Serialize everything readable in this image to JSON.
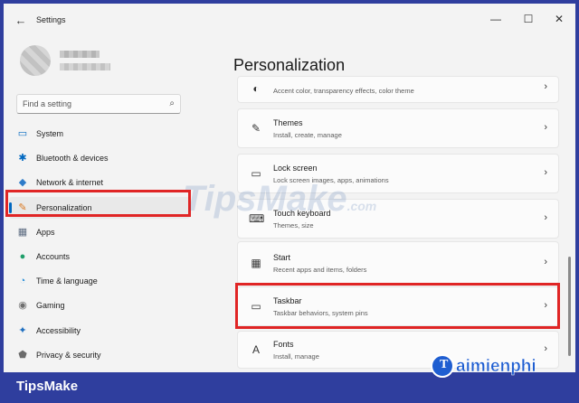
{
  "window": {
    "title": "Settings"
  },
  "controls": {
    "back": "←",
    "minimize": "—",
    "maximize": "☐",
    "close": "✕"
  },
  "search": {
    "placeholder": "Find a setting",
    "icon": "⌕"
  },
  "sidebar": {
    "items": [
      {
        "label": "System",
        "icon": "▭",
        "color": "#0067c0"
      },
      {
        "label": "Bluetooth & devices",
        "icon": "✱",
        "color": "#0067c0"
      },
      {
        "label": "Network & internet",
        "icon": "◆",
        "color": "#2f7cc9"
      },
      {
        "label": "Personalization",
        "icon": "✎",
        "color": "#d9771f",
        "active": true
      },
      {
        "label": "Apps",
        "icon": "▦",
        "color": "#5c6b80"
      },
      {
        "label": "Accounts",
        "icon": "●",
        "color": "#1f9e6a"
      },
      {
        "label": "Time & language",
        "icon": "◔",
        "color": "#2a8fd8"
      },
      {
        "label": "Gaming",
        "icon": "◉",
        "color": "#6f6f6f"
      },
      {
        "label": "Accessibility",
        "icon": "✦",
        "color": "#1f6fc0"
      },
      {
        "label": "Privacy & security",
        "icon": "⬟",
        "color": "#6b6b6b"
      }
    ]
  },
  "main": {
    "title": "Personalization",
    "cards": [
      {
        "title": "",
        "subtitle": "Accent color, transparency effects, color theme",
        "icon": "◐",
        "chevron": "›"
      },
      {
        "title": "Themes",
        "subtitle": "Install, create, manage",
        "icon": "✎",
        "chevron": "›"
      },
      {
        "title": "Lock screen",
        "subtitle": "Lock screen images, apps, animations",
        "icon": "▭",
        "chevron": "›"
      },
      {
        "title": "Touch keyboard",
        "subtitle": "Themes, size",
        "icon": "⌨",
        "chevron": "›"
      },
      {
        "title": "Start",
        "subtitle": "Recent apps and items, folders",
        "icon": "▦",
        "chevron": "›"
      },
      {
        "title": "Taskbar",
        "subtitle": "Taskbar behaviors, system pins",
        "icon": "▭",
        "chevron": "›"
      },
      {
        "title": "Fonts",
        "subtitle": "Install, manage",
        "icon": "A",
        "chevron": "›"
      }
    ]
  },
  "watermark": {
    "center": "TipsMake",
    "center_suffix": ".com",
    "logo_letter": "T",
    "logo": "aimienphi"
  },
  "footer": {
    "brand": "TipsMake"
  },
  "colors": {
    "accent": "#0067c0",
    "highlight": "#e02525",
    "frame": "#2f3e9e"
  }
}
